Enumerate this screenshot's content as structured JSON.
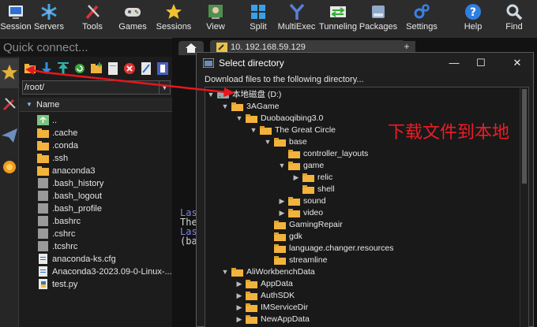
{
  "toolbar": {
    "items": [
      {
        "label": "Session",
        "icon": "session-icon"
      },
      {
        "label": "Servers",
        "icon": "servers-icon"
      },
      {
        "label": "Tools",
        "icon": "tools-icon"
      },
      {
        "label": "Games",
        "icon": "games-icon"
      },
      {
        "label": "Sessions",
        "icon": "star-icon"
      },
      {
        "label": "View",
        "icon": "view-icon"
      },
      {
        "label": "Split",
        "icon": "split-icon"
      },
      {
        "label": "MultiExec",
        "icon": "multiexec-icon"
      },
      {
        "label": "Tunneling",
        "icon": "tunneling-icon"
      },
      {
        "label": "Packages",
        "icon": "packages-icon"
      },
      {
        "label": "Settings",
        "icon": "settings-icon"
      },
      {
        "label": "Help",
        "icon": "help-icon"
      },
      {
        "label": "Find",
        "icon": "find-icon"
      }
    ]
  },
  "quick_connect": {
    "placeholder": "Quick connect..."
  },
  "sftp": {
    "path": "/root/",
    "column": "Name",
    "files": [
      {
        "name": "..",
        "type": "up"
      },
      {
        "name": ".cache",
        "type": "folder"
      },
      {
        "name": ".conda",
        "type": "folder"
      },
      {
        "name": ".ssh",
        "type": "folder"
      },
      {
        "name": "anaconda3",
        "type": "folder"
      },
      {
        "name": ".bash_history",
        "type": "file"
      },
      {
        "name": ".bash_logout",
        "type": "file"
      },
      {
        "name": ".bash_profile",
        "type": "file"
      },
      {
        "name": ".bashrc",
        "type": "file"
      },
      {
        "name": ".cshrc",
        "type": "file"
      },
      {
        "name": ".tcshrc",
        "type": "file"
      },
      {
        "name": "anaconda-ks.cfg",
        "type": "doc"
      },
      {
        "name": "Anaconda3-2023.09-0-Linux-...",
        "type": "doc"
      },
      {
        "name": "test.py",
        "type": "python"
      }
    ]
  },
  "terminal": {
    "tab_title": "10. 192.168.59.129",
    "lines": [
      {
        "text": "Las",
        "color": "#7f86e0"
      },
      {
        "text": "The",
        "color": "#d7d7d7"
      },
      {
        "text": "Las",
        "color": "#7f86e0"
      },
      {
        "text": "(ba",
        "color": "#d7d7d7"
      }
    ]
  },
  "dialog": {
    "title": "Select directory",
    "subtitle": "Download files to the following directory...",
    "tree": [
      {
        "label": "本地磁盘 (D:)",
        "depth": 0,
        "toggle": "open",
        "icon": "drive"
      },
      {
        "label": "3AGame",
        "depth": 1,
        "toggle": "open",
        "icon": "folder"
      },
      {
        "label": "Duobaoqibing3.0",
        "depth": 2,
        "toggle": "open",
        "icon": "folder"
      },
      {
        "label": "The Great Circle",
        "depth": 3,
        "toggle": "open",
        "icon": "folder"
      },
      {
        "label": "base",
        "depth": 4,
        "toggle": "open",
        "icon": "folder"
      },
      {
        "label": "controller_layouts",
        "depth": 5,
        "toggle": "",
        "icon": "folder"
      },
      {
        "label": "game",
        "depth": 5,
        "toggle": "open",
        "icon": "folder"
      },
      {
        "label": "relic",
        "depth": 6,
        "toggle": "closed",
        "icon": "folder"
      },
      {
        "label": "shell",
        "depth": 6,
        "toggle": "",
        "icon": "folder"
      },
      {
        "label": "sound",
        "depth": 5,
        "toggle": "closed",
        "icon": "folder"
      },
      {
        "label": "video",
        "depth": 5,
        "toggle": "closed",
        "icon": "folder"
      },
      {
        "label": "GamingRepair",
        "depth": 4,
        "toggle": "",
        "icon": "folder"
      },
      {
        "label": "gdk",
        "depth": 4,
        "toggle": "",
        "icon": "folder"
      },
      {
        "label": "language.changer.resources",
        "depth": 4,
        "toggle": "",
        "icon": "folder"
      },
      {
        "label": "streamline",
        "depth": 4,
        "toggle": "",
        "icon": "folder"
      },
      {
        "label": "AliWorkbenchData",
        "depth": 1,
        "toggle": "open",
        "icon": "folder"
      },
      {
        "label": "AppData",
        "depth": 2,
        "toggle": "closed",
        "icon": "folder"
      },
      {
        "label": "AuthSDK",
        "depth": 2,
        "toggle": "closed",
        "icon": "folder"
      },
      {
        "label": "IMServiceDir",
        "depth": 2,
        "toggle": "closed",
        "icon": "folder"
      },
      {
        "label": "NewAppData",
        "depth": 2,
        "toggle": "closed",
        "icon": "folder"
      }
    ]
  },
  "annotation": {
    "text": "下载文件到本地",
    "color": "#ee1c25"
  },
  "colors": {
    "folder": "#f2b33d",
    "toolbar_bg": "#2c2c2c",
    "annotation": "#ee1c25"
  }
}
